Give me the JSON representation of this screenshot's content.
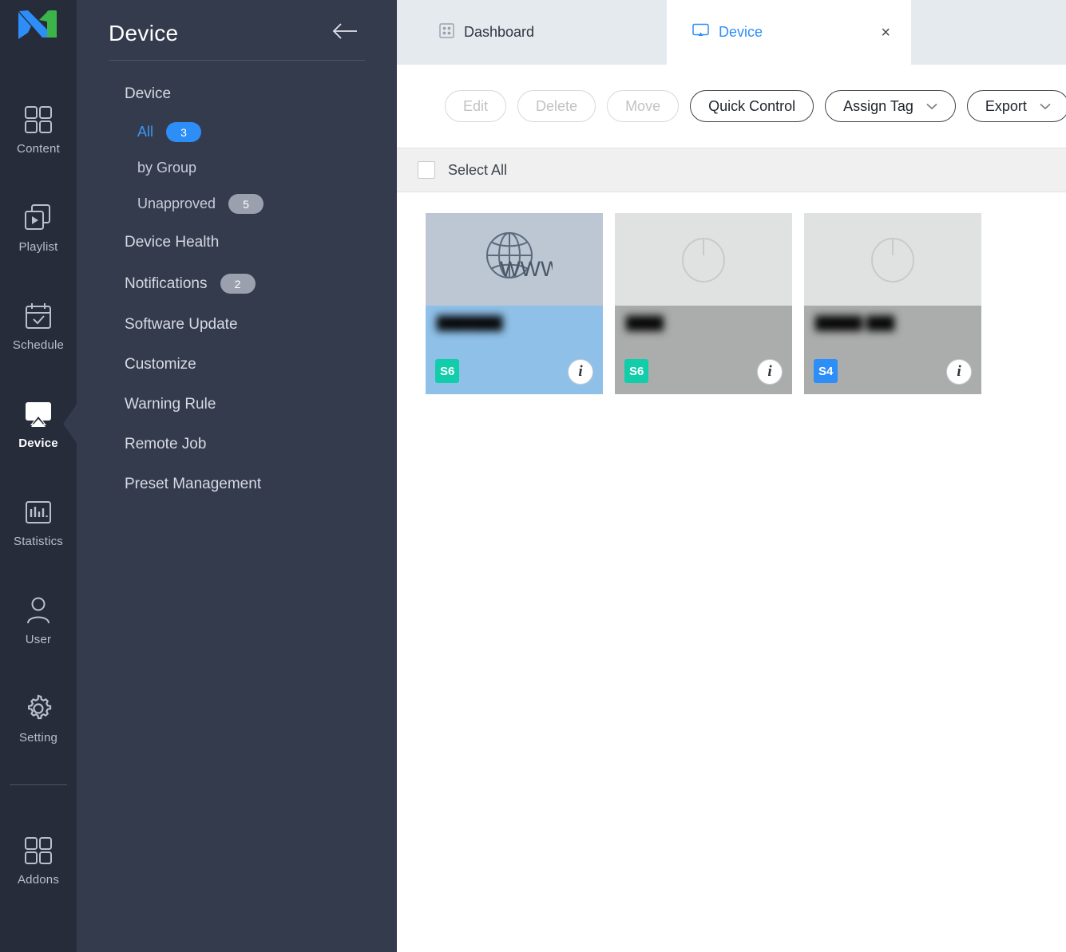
{
  "rail": {
    "logo_name": "magicinfo-logo",
    "items": [
      {
        "label": "Content",
        "icon": "grid-icon",
        "active": false
      },
      {
        "label": "Playlist",
        "icon": "playlist-icon",
        "active": false
      },
      {
        "label": "Schedule",
        "icon": "calendar-icon",
        "active": false
      },
      {
        "label": "Device",
        "icon": "device-icon",
        "active": true
      },
      {
        "label": "Statistics",
        "icon": "bar-chart-icon",
        "active": false
      },
      {
        "label": "User",
        "icon": "user-icon",
        "active": false
      },
      {
        "label": "Setting",
        "icon": "gear-icon",
        "active": false
      },
      {
        "label": "Addons",
        "icon": "grid-icon",
        "active": false
      }
    ]
  },
  "panel": {
    "title": "Device",
    "back_icon": "arrow-left-icon",
    "group_label": "Device",
    "sub_items": [
      {
        "label": "All",
        "badge": "3",
        "badge_color": "blue",
        "selected": true
      },
      {
        "label": "by Group",
        "badge": "",
        "badge_color": "",
        "selected": false
      },
      {
        "label": "Unapproved",
        "badge": "5",
        "badge_color": "grey",
        "selected": false
      }
    ],
    "items": [
      {
        "label": "Device Health",
        "badge": ""
      },
      {
        "label": "Notifications",
        "badge": "2"
      },
      {
        "label": "Software Update",
        "badge": ""
      },
      {
        "label": "Customize",
        "badge": ""
      },
      {
        "label": "Warning Rule",
        "badge": ""
      },
      {
        "label": "Remote Job",
        "badge": ""
      },
      {
        "label": "Preset Management",
        "badge": ""
      }
    ]
  },
  "tabs": [
    {
      "label": "Dashboard",
      "icon": "dashboard-grid-icon",
      "active": false,
      "closable": false
    },
    {
      "label": "Device",
      "icon": "monitor-icon",
      "active": true,
      "closable": true,
      "close_glyph": "×"
    }
  ],
  "toolbar": {
    "buttons": [
      {
        "label": "Edit",
        "state": "disabled",
        "caret": false
      },
      {
        "label": "Delete",
        "state": "disabled",
        "caret": false
      },
      {
        "label": "Move",
        "state": "disabled",
        "caret": false
      },
      {
        "label": "Quick Control",
        "state": "enabled",
        "caret": false
      },
      {
        "label": "Assign Tag",
        "state": "enabled",
        "caret": true
      },
      {
        "label": "Export",
        "state": "enabled",
        "caret": true
      }
    ]
  },
  "list_header": {
    "select_all_label": "Select All",
    "select_all_checked": false
  },
  "devices": [
    {
      "name": "███████",
      "thumb_icon": "www-globe-icon",
      "thumb_bg": "#bdc7d3",
      "body_bg": "#8fc0e8",
      "selected": true,
      "tag": "S6",
      "tag_color": "#12cdaa"
    },
    {
      "name": "████",
      "thumb_icon": "power-icon",
      "thumb_bg": "#e0e1e1",
      "body_bg": "#abacac",
      "selected": false,
      "tag": "S6",
      "tag_color": "#12cdaa"
    },
    {
      "name": "█████  ███",
      "thumb_icon": "power-icon",
      "thumb_bg": "#e0e1e1",
      "body_bg": "#abacac",
      "selected": false,
      "tag": "S4",
      "tag_color": "#2e8ef7"
    }
  ],
  "colors": {
    "rail_bg": "#262c3a",
    "panel_bg": "#343b4d",
    "accent_blue": "#2e8ef7",
    "tabbar_bg": "#e5eaef",
    "selectall_bg": "#f0f0f0",
    "badge_green": "#12cdaa"
  }
}
